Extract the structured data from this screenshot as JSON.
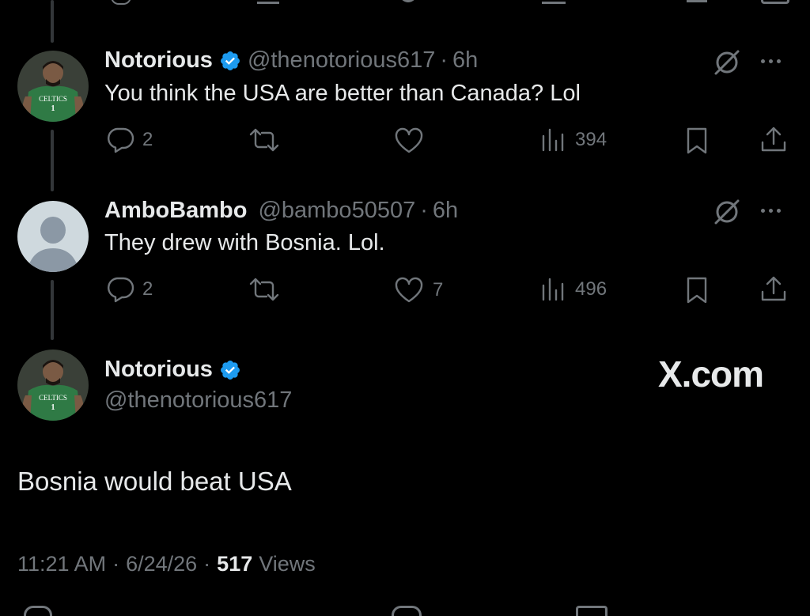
{
  "replies": [
    {
      "name": "Notorious",
      "handle": "@thenotorious617",
      "time": "6h",
      "text": "You think the USA are better than Canada? Lol",
      "replies": "2",
      "retweets": "",
      "likes": "",
      "views": "394",
      "avatar_jersey_text": "CELTICS",
      "avatar_jersey_number": "1"
    },
    {
      "name": "AmboBambo",
      "handle": "@bambo50507",
      "time": "6h",
      "text": "They drew with Bosnia. Lol.",
      "replies": "2",
      "retweets": "",
      "likes": "7",
      "views": "496"
    }
  ],
  "main_post": {
    "name": "Notorious",
    "handle": "@thenotorious617",
    "text": "Bosnia would beat USA",
    "time": "11:21 AM",
    "date": "6/24/26",
    "views_count": "517",
    "views_label": "Views",
    "avatar_jersey_text": "CELTICS",
    "avatar_jersey_number": "1"
  },
  "watermark": "X.com",
  "separator": "·",
  "colors": {
    "background": "#000000",
    "text": "#e7e9ea",
    "muted": "#71767b",
    "verified": "#1d9bf0",
    "jersey": "#2f7a45"
  },
  "icons": [
    "reply-icon",
    "retweet-icon",
    "like-icon",
    "views-icon",
    "bookmark-icon",
    "share-icon",
    "grok-icon",
    "more-icon",
    "verified-badge-icon"
  ]
}
